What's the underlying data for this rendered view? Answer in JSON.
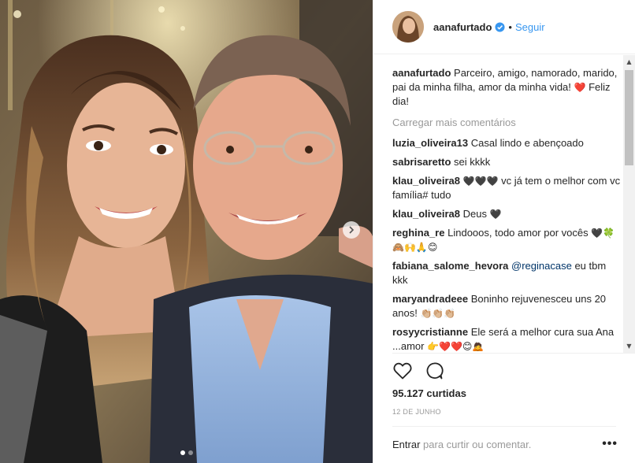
{
  "post": {
    "username": "aanafurtado",
    "follow_label": "Seguir",
    "separator": "•",
    "caption": {
      "username": "aanafurtado",
      "text": "Parceiro, amigo, namorado, marido, pai da minha filha, amor da minha vida!",
      "emoji": "❤️",
      "text_after": "Feliz dia!"
    },
    "load_more": "Carregar mais comentários",
    "comments": [
      {
        "username": "luzia_oliveira13",
        "text": "Casal lindo e abençoado"
      },
      {
        "username": "sabrisaretto",
        "text": "sei kkkk"
      },
      {
        "username": "klau_oliveira8",
        "emoji": "🖤🖤🖤",
        "text": "vc já tem o melhor com vc família# tudo"
      },
      {
        "username": "klau_oliveira8",
        "text": "Deus",
        "emoji_after": "🖤"
      },
      {
        "username": "reghina_re",
        "text": "Lindooos, todo amor por vocês",
        "emoji_after": "🖤🍀🙈🙌🙏😊"
      },
      {
        "username": "fabiana_salome_hevora",
        "mention": "@reginacase",
        "text": "eu tbm kkk"
      },
      {
        "username": "maryandradeee",
        "text": "Boninho rejuvenesceu uns 20 anos!",
        "emoji_after": "👏🏼👏🏼👏🏼"
      },
      {
        "username": "rosyycristianne",
        "text": "Ele será a melhor cura sua Ana ...amor",
        "emoji_after": "👉❤️❤️😊🙇"
      }
    ],
    "likes": "95.127 curtidas",
    "date": "12 DE JUNHO",
    "login_prompt": {
      "link": "Entrar",
      "text": "para curtir ou comentar."
    },
    "more_options": "•••",
    "carousel": {
      "total_slides": 2,
      "active_slide": 1
    }
  },
  "icons": {
    "verified": "verified-badge-icon",
    "like": "heart-icon",
    "comment": "comment-bubble-icon",
    "next": "chevron-right-icon"
  },
  "colors": {
    "link": "#3897f0",
    "verified": "#3897f0",
    "heart": "#ed4956",
    "muted": "#999999",
    "text": "#262626"
  }
}
